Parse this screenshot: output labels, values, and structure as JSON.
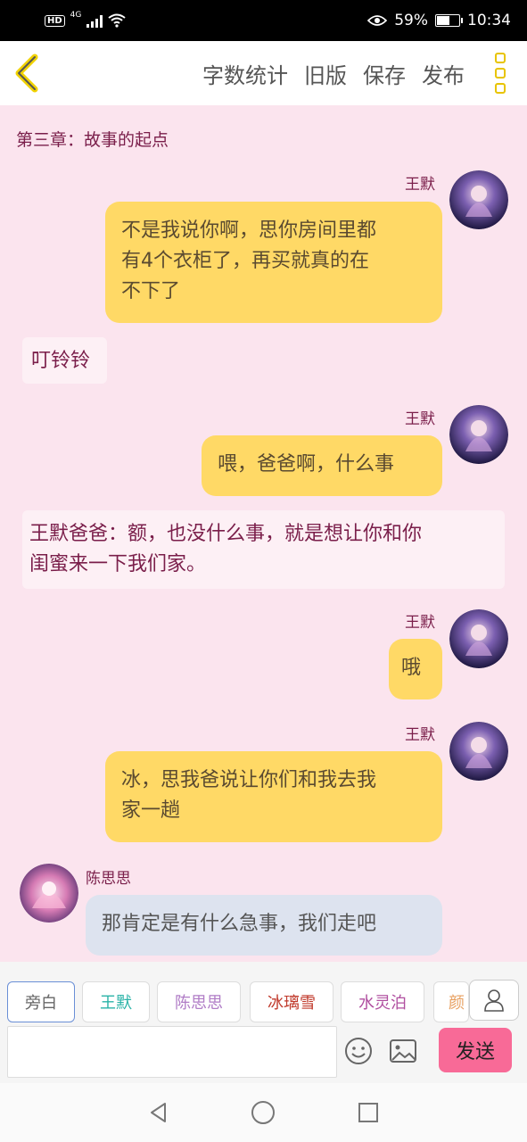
{
  "status": {
    "network": "4G",
    "battery_text": "59%",
    "battery_level": 0.59,
    "time": "10:34"
  },
  "toolbar": {
    "word_count": "字数统计",
    "old_version": "旧版",
    "save": "保存",
    "publish": "发布"
  },
  "chapter": {
    "title": "第三章：故事的起点"
  },
  "messages": [
    {
      "speaker": "王默",
      "side": "right",
      "text_lines": [
        "不是我说你啊，思你房间里都",
        "有4个衣柜了，再买就真的在",
        "不下了"
      ]
    },
    {
      "type": "narration",
      "text": "叮铃铃"
    },
    {
      "speaker": "王默",
      "side": "right",
      "text": "喂，爸爸啊，什么事"
    },
    {
      "type": "narration",
      "text_lines": [
        "王默爸爸：额，也没什么事，就是想让你和你",
        "闺蜜来一下我们家。"
      ]
    },
    {
      "speaker": "王默",
      "side": "right",
      "text": "哦"
    },
    {
      "speaker": "王默",
      "side": "right",
      "text_lines": [
        "冰，思我爸说让你们和我去我",
        "家一趟"
      ]
    },
    {
      "speaker": "陈思思",
      "side": "left",
      "text": "那肯定是有什么急事，我们走吧"
    }
  ],
  "roles": [
    {
      "label": "旁白",
      "color": "#666666"
    },
    {
      "label": "王默",
      "color": "#2bb3a8"
    },
    {
      "label": "陈思思",
      "color": "#b07cc6"
    },
    {
      "label": "冰璃雪",
      "color": "#c0392b"
    },
    {
      "label": "水灵泊",
      "color": "#b04fa0"
    },
    {
      "label": "颜",
      "color": "#e8a060"
    }
  ],
  "composer": {
    "placeholder": "",
    "send_label": "发送"
  }
}
